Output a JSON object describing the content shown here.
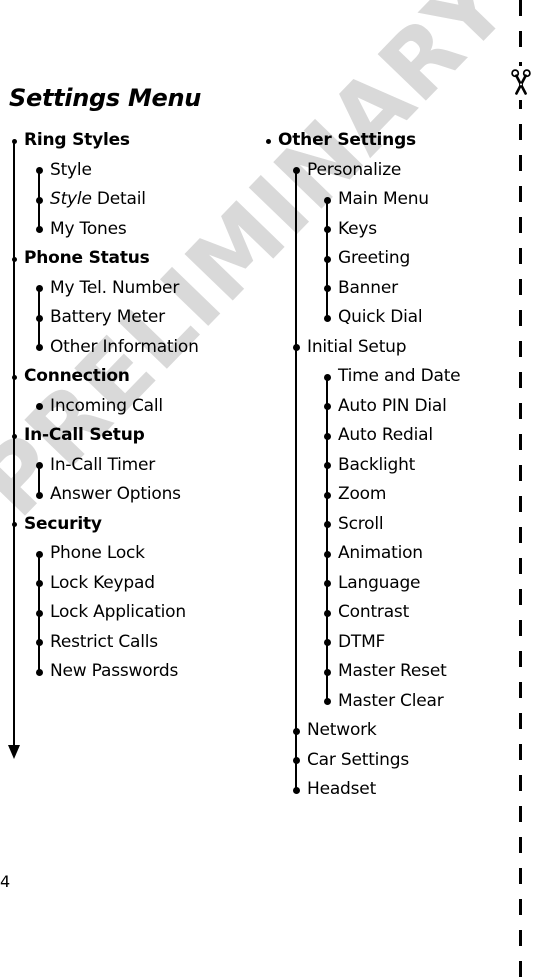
{
  "document": {
    "title": "Settings Menu",
    "page_number": "4",
    "watermark": "PRELIMINARY",
    "watermark_color": "#d9d9d9",
    "cut_marker_icon": "scissors-icon"
  },
  "left_column": [
    {
      "label": "Ring Styles",
      "children": [
        {
          "label": "Style"
        },
        {
          "label": "Style Detail",
          "italic_prefix": "Style",
          "rest": " Detail"
        },
        {
          "label": "My Tones"
        }
      ]
    },
    {
      "label": "Phone Status",
      "children": [
        {
          "label": "My Tel. Number"
        },
        {
          "label": "Battery Meter"
        },
        {
          "label": "Other Information"
        }
      ]
    },
    {
      "label": "Connection",
      "children": [
        {
          "label": "Incoming Call"
        }
      ]
    },
    {
      "label": "In-Call Setup",
      "children": [
        {
          "label": "In-Call Timer"
        },
        {
          "label": "Answer Options"
        }
      ]
    },
    {
      "label": "Security",
      "children": [
        {
          "label": "Phone Lock"
        },
        {
          "label": "Lock Keypad"
        },
        {
          "label": "Lock Application"
        },
        {
          "label": "Restrict Calls"
        },
        {
          "label": "New Passwords"
        }
      ]
    }
  ],
  "right_column": [
    {
      "label": "Other Settings",
      "children": [
        {
          "label": "Personalize",
          "children": [
            {
              "label": "Main Menu"
            },
            {
              "label": "Keys"
            },
            {
              "label": "Greeting"
            },
            {
              "label": "Banner"
            },
            {
              "label": "Quick Dial"
            }
          ]
        },
        {
          "label": "Initial Setup",
          "children": [
            {
              "label": "Time and Date"
            },
            {
              "label": "Auto PIN Dial"
            },
            {
              "label": "Auto Redial"
            },
            {
              "label": "Backlight"
            },
            {
              "label": "Zoom"
            },
            {
              "label": "Scroll"
            },
            {
              "label": "Animation"
            },
            {
              "label": "Language"
            },
            {
              "label": "Contrast"
            },
            {
              "label": "DTMF"
            },
            {
              "label": "Master Reset"
            },
            {
              "label": "Master Clear"
            }
          ]
        },
        {
          "label": "Network",
          "children": []
        },
        {
          "label": "Car Settings",
          "children": []
        },
        {
          "label": "Headset",
          "children": []
        }
      ]
    }
  ]
}
